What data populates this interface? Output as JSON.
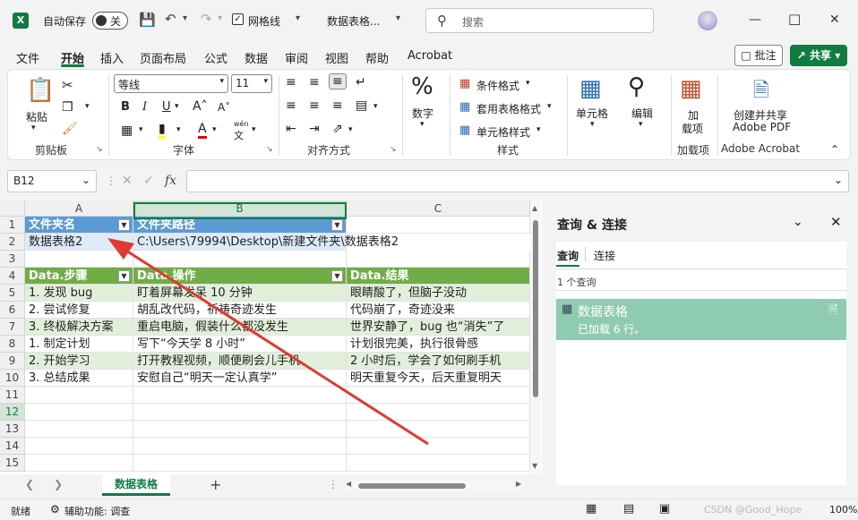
{
  "titlebar": {
    "logo": "X",
    "autosave_label": "自动保存",
    "autosave_state": "关",
    "gridlines_label": "网格线",
    "file_name": "数据表格...",
    "search_placeholder": "搜索"
  },
  "menu": [
    "文件",
    "开始",
    "插入",
    "页面布局",
    "公式",
    "数据",
    "审阅",
    "视图",
    "帮助",
    "Acrobat"
  ],
  "actions": {
    "comment": "批注",
    "share": "共享"
  },
  "ribbon": {
    "paste": "粘贴",
    "clipboard": "剪贴板",
    "font_name": "等线",
    "font_size": "11",
    "font_group": "字体",
    "align_group": "对齐方式",
    "number": "数字",
    "cond_format": "条件格式",
    "table_format": "套用表格格式",
    "cell_style": "单元格样式",
    "style_group": "样式",
    "cells": "单元格",
    "edit": "编辑",
    "addin_line1": "加",
    "addin_line2": "载项",
    "addin_group": "加载项",
    "pdf_line1": "创建并共享",
    "pdf_line2": "Adobe PDF",
    "acrobat_group": "Adobe Acrobat",
    "wen": "wén",
    "wen_char": "文"
  },
  "formula_bar": {
    "name_box": "B12",
    "fx": "fx",
    "value": ""
  },
  "columns": [
    "A",
    "B",
    "C"
  ],
  "rows": [
    "1",
    "2",
    "3",
    "4",
    "5",
    "6",
    "7",
    "8",
    "9",
    "10",
    "11",
    "12",
    "13",
    "14",
    "15"
  ],
  "table1": {
    "headers": [
      "文件夹名",
      "文件夹路径"
    ],
    "row": [
      "数据表格2",
      "C:\\Users\\79994\\Desktop\\新建文件夹\\数据表格2"
    ]
  },
  "table2": {
    "headers": [
      "Data.步骤",
      "Data.操作",
      "Data.结果"
    ],
    "rows": [
      [
        "1. 发现 bug",
        "盯着屏幕发呆 10 分钟",
        "眼睛酸了，但脑子没动"
      ],
      [
        "2. 尝试修复",
        "胡乱改代码，祈祷奇迹发生",
        "代码崩了，奇迹没来"
      ],
      [
        "3. 终极解决方案",
        "重启电脑，假装什么都没发生",
        "世界安静了，bug 也“消失”了"
      ],
      [
        "1. 制定计划",
        "写下“今天学 8 小时”",
        "计划很完美，执行很骨感"
      ],
      [
        "2. 开始学习",
        "打开教程视频，顺便刷会儿手机",
        "2 小时后，学会了如何刷手机"
      ],
      [
        "3. 总结成果",
        "安慰自己“明天一定认真学”",
        "明天重复今天，后天重复明天"
      ]
    ]
  },
  "sheet_tab": "数据表格",
  "pane": {
    "title": "查询 & 连接",
    "tab_queries": "查询",
    "tab_connections": "连接",
    "count": "1 个查询",
    "query_name": "数据表格",
    "query_status": "已加载 6 行。"
  },
  "status": {
    "ready": "就绪",
    "accessibility": "辅助功能: 调查",
    "zoom": "100%",
    "watermark": "CSDN @Good_Hope"
  },
  "colors": {
    "excel_green": "#107c41",
    "header_blue": "#5b9bd5",
    "header_green": "#70ad47",
    "arrow_red": "#e03a2f"
  }
}
